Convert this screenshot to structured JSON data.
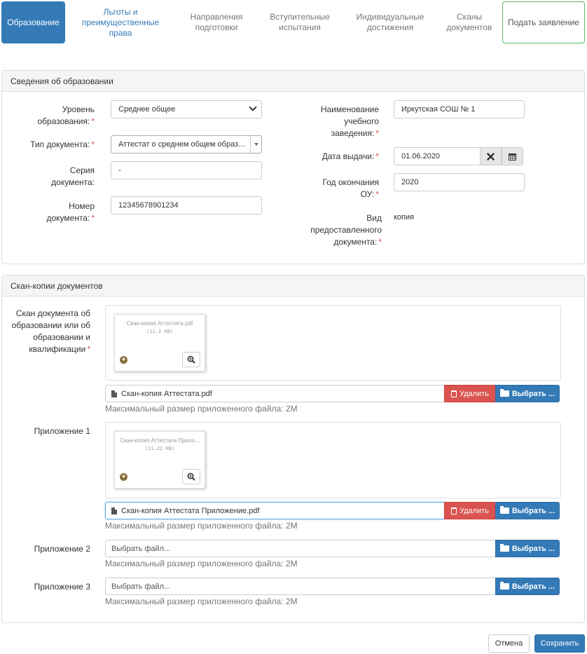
{
  "tabs": [
    {
      "label": "Образование"
    },
    {
      "label": "Льготы и преимущественные права"
    },
    {
      "label": "Направления подготовки"
    },
    {
      "label": "Вступительные испытания"
    },
    {
      "label": "Индивидуальные достижения"
    },
    {
      "label": "Сканы документов"
    },
    {
      "label": "Подать заявление"
    }
  ],
  "education": {
    "heading": "Сведения об образовании",
    "level_label": "Уровень образования:",
    "level_value": "Среднее общее",
    "doc_type_label": "Тип документа:",
    "doc_type_value": "Аттестат о среднем общем образов...",
    "series_label": "Серия документа:",
    "series_value": "-",
    "number_label": "Номер документа:",
    "number_value": "12345678901234",
    "institution_label": "Наименование учебного заведения:",
    "institution_value": "Иркутская СОШ № 1",
    "issue_date_label": "Дата выдачи:",
    "issue_date_value": "01.06.2020",
    "grad_year_label": "Год окончания ОУ:",
    "grad_year_value": "2020",
    "doc_kind_label": "Вид предоставленного документа:",
    "doc_kind_value": "копия",
    "required_mark": "*"
  },
  "scans": {
    "heading": "Скан-копии документов",
    "max_size_hint": "Максимальный размер приложенного файла: 2M",
    "delete_label": "Удалить",
    "pick_label": "Выбрать ...",
    "placeholder": "Выбрать файл...",
    "items": [
      {
        "label": "Скан документа об образовании или об образовании и квалификации",
        "file": "Скан-копия Аттестата.pdf",
        "thumb_name": "Скан-копия Аттестата.pdf",
        "thumb_size": "(11.2 KB)"
      },
      {
        "label": "Приложение 1",
        "file": "Скан-копия Аттестата Приложение.pdf",
        "thumb_name": "Скан-копия Аттестата Прило...",
        "thumb_size": "(11.22 KB)"
      },
      {
        "label": "Приложение 2"
      },
      {
        "label": "Приложение 3"
      }
    ]
  },
  "footer": {
    "cancel_label": "Отмена",
    "save_label": "Сохранить"
  },
  "colors": {
    "primary": "#337ab7",
    "danger": "#d9534f",
    "success_border": "#5cb85c",
    "required": "#d9534f"
  }
}
